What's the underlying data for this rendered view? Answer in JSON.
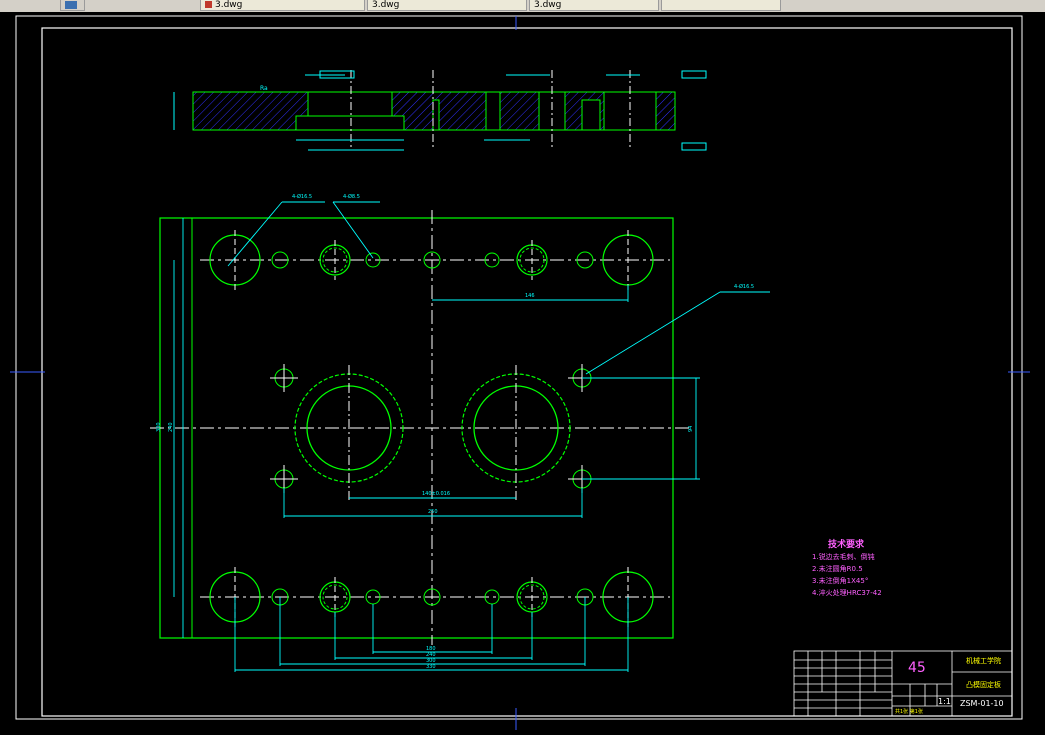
{
  "tabs": [
    {
      "label": "",
      "icon": "app-icon"
    },
    {
      "label": "",
      "icon": "drawing-icon"
    },
    {
      "label": "3.dwg"
    },
    {
      "label": "3.dwg"
    },
    {
      "label": "3.dwg"
    },
    {
      "label": ""
    }
  ],
  "dimensions": {
    "d_hole_tl": "4-Ø16.5",
    "d_hole_tl2": "4-Ø8.5",
    "d_hole_r": "4-Ø16.5",
    "w_146": "146",
    "w_145": "140±0.016",
    "w_250": "250",
    "h_94": "94",
    "h_total": "300",
    "h_inner": "240",
    "b1": "180",
    "b2": "240",
    "b3": "300",
    "b4": "330"
  },
  "tech": {
    "title": "技术要求",
    "items": [
      "1.锐边去毛刺、倒钝",
      "2.未注圆角R0.5",
      "3.未注倒角1X45°",
      "4.淬火处理HRC37-42"
    ]
  },
  "title_block": {
    "material": "45",
    "company": "机械工学院",
    "part_name": "凸模固定板",
    "scale": "1:1",
    "drawing_no": "ZSM-01-10",
    "sheet": "共1张 第1张"
  },
  "colors": {
    "border": "#ffffff",
    "geometry": "#00ff00",
    "dims": "#00ffff",
    "center": "#ffffff",
    "hatch": "#3030ff",
    "text": "#ff60ff"
  }
}
